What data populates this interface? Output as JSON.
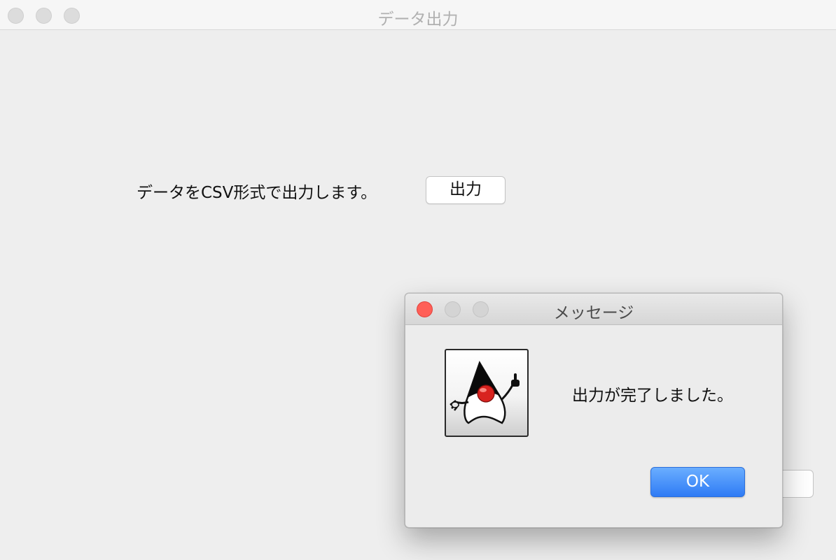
{
  "main_window": {
    "title": "データ出力",
    "description": "データをCSV形式で出力します。",
    "output_button_label": "出力",
    "partially_hidden_button_label": "\\"
  },
  "dialog": {
    "title": "メッセージ",
    "icon": "duke-icon",
    "message": "出力が完了しました。",
    "ok_label": "OK"
  },
  "colors": {
    "close_button": "#ff5f57",
    "ok_button": "#2f7bf5"
  }
}
